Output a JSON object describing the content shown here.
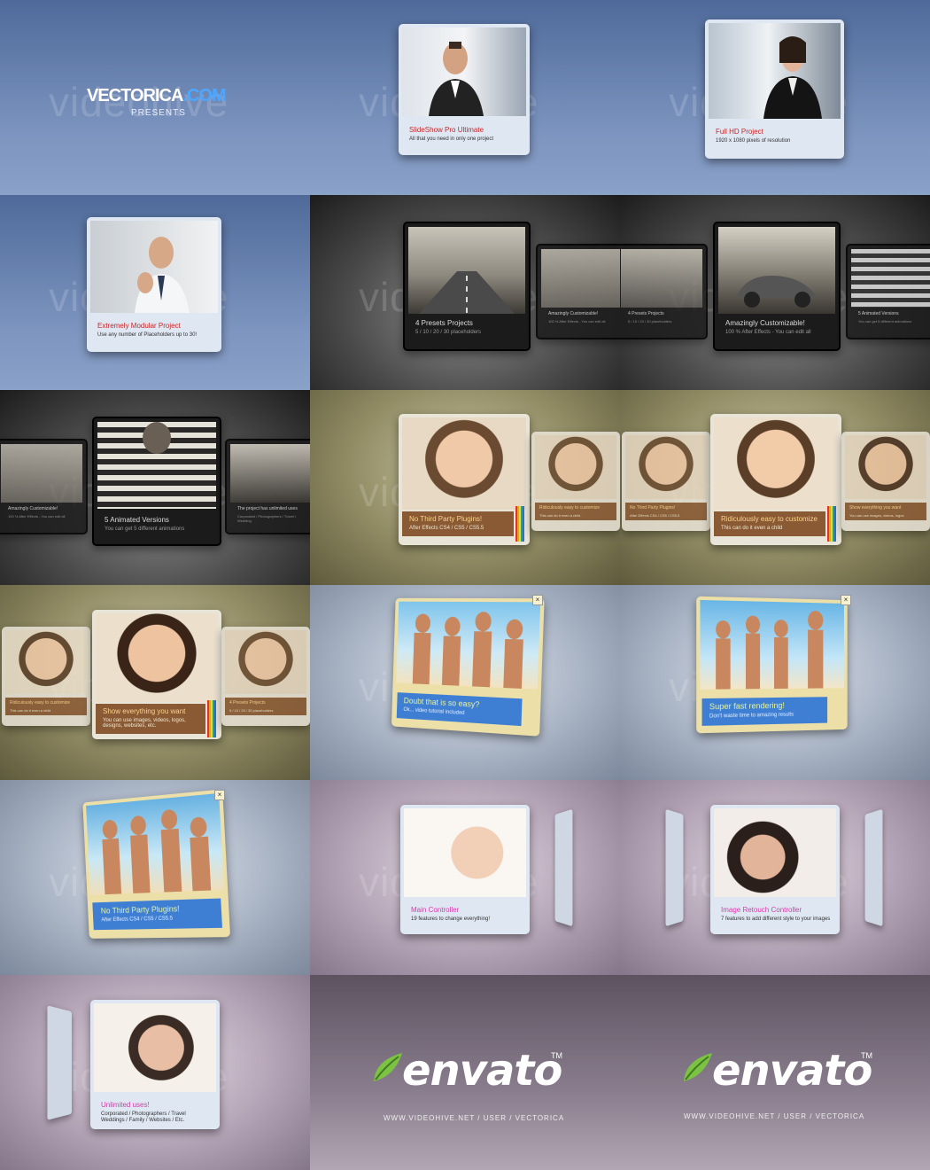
{
  "watermark": "videohive",
  "intro": {
    "brand_main": "VECTORICA",
    "brand_accent": ".COM",
    "subtitle": "PRESENTS"
  },
  "cards": {
    "c2": {
      "title": "SlideShow Pro Ultimate",
      "desc": "All that you need in only one project"
    },
    "c3": {
      "title": "Full HD Project",
      "desc": "1920 x 1080 pixels of resolution"
    },
    "c4": {
      "title": "Extremely Modular Project",
      "desc": "Use any number of Placeholders up to 30!"
    },
    "c5": {
      "title": "4 Presets Projects",
      "desc": "5 / 10 / 20 / 30 placeholders",
      "side_title": "Amazingly Customizable!",
      "side_desc": "100 % After Effects - You can edit all"
    },
    "c6": {
      "title": "Amazingly Customizable!",
      "desc": "100 % After Effects - You can edit all",
      "left_title": "4 Presets Projects",
      "left_desc": "5 / 10 / 20 / 30 placeholders",
      "right_title": "5 Animated Versions",
      "right_desc": "You can get 5 different animations"
    },
    "c7": {
      "title": "5 Animated Versions",
      "desc": "You can get 5 different animations",
      "left_title": "Amazingly Customizable!",
      "left_desc": "100 % After Effects - You can edit all",
      "right_title": "The project has unlimited uses",
      "right_desc": "Corporated / Photographers / Travel / Wedding"
    },
    "c8": {
      "title": "No Third Party Plugins!",
      "desc": "After Effects CS4 / CS5 / CS5.5",
      "side_title": "Ridiculously easy to customize",
      "side_desc": "This can do it even a child"
    },
    "c9": {
      "title": "Ridiculously easy to customize",
      "desc": "This can do it even a child",
      "left_title": "No Third Party Plugins!",
      "left_desc": "After Effects CS4 / CS5 / CS5.5",
      "right_title": "Show everything you want",
      "right_desc": "You can use images, videos, logos"
    },
    "c10": {
      "title": "Show everything you want",
      "desc": "You can use images, videos, logos, designs, websites, etc.",
      "left_title": "Ridiculously easy to customize",
      "left_desc": "This can do it even a child",
      "right_title": "4 Presets Projects",
      "right_desc": "5 / 10 / 20 / 30 placeholders"
    },
    "c11": {
      "title": "Doubt that is so easy?",
      "desc": "Ok... video tutorial included"
    },
    "c12": {
      "title": "Super fast rendering!",
      "desc": "Don't waste time to amazing results"
    },
    "c13": {
      "title": "No Third Party Plugins!",
      "desc": "After Effects CS4 / CS5 / CS5.5"
    },
    "c14": {
      "title": "Main Controller",
      "desc": "19 features to change everything!"
    },
    "c15": {
      "title": "Image Retouch Controller",
      "desc": "7 features to add different style to your images"
    },
    "c16": {
      "title": "Unlimited uses!",
      "desc": "Corporated / Photographers / Travel",
      "desc2": "Weddings / Family / Websites / Etc."
    }
  },
  "outro": {
    "logo": "envato",
    "tm": "TM",
    "url1": "WWW.VIDEOHIVE.NET / USER / VECTORICA",
    "url2": "WWW.VIDEOHIVE.NET / USER / VECTORICA"
  },
  "colors": {
    "blue_bg": "#6b84b2",
    "dark_bg": "#3a3a3a",
    "olive_bg": "#8f8a62",
    "steel_bg": "#a8b3c4",
    "mauve_bg": "#b3a3b6",
    "plum_bg": "#8a7e8e",
    "accent_red": "#c62828",
    "accent_blue": "#3f7fd3",
    "envato_green": "#7cc243"
  }
}
